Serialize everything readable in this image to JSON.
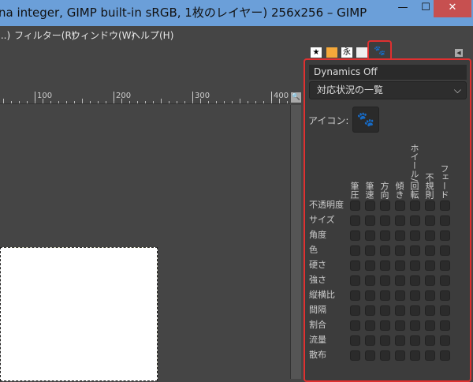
{
  "window": {
    "title": "na integer, GIMP built-in sRGB, 1枚のレイヤー) 256x256 – GIMP",
    "minimize": "—",
    "maximize": "☐",
    "close": "✕"
  },
  "menu": [
    "...)",
    "フィルター(R)",
    "ウィンドウ(W)",
    "ヘルプ(H)"
  ],
  "ruler": {
    "labels": [
      "100",
      "200",
      "300",
      "400"
    ]
  },
  "dock": {
    "tabs": [
      "★",
      "▮",
      "永",
      "▫"
    ],
    "active_tab_icon": "paint-dynamics-icon",
    "dynamics_name": "Dynamics Off",
    "view_select": "対応状況の一覧",
    "icon_label": "アイコン:",
    "icon_glyph": "🐾",
    "columns": [
      "筆圧",
      "筆速",
      "方向",
      "傾き",
      "ホイール/回転",
      "不規則",
      "フェード"
    ],
    "rows": [
      "不透明度",
      "サイズ",
      "角度",
      "色",
      "硬さ",
      "強さ",
      "縦横比",
      "間隔",
      "割合",
      "流量",
      "散布"
    ]
  }
}
